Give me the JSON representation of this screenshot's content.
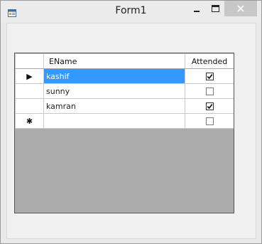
{
  "window": {
    "title": "Form1",
    "minimize_glyph": "—",
    "maximize_glyph": "☐",
    "close_glyph": "✕"
  },
  "grid": {
    "columns": [
      "EName",
      "Attended"
    ],
    "current_row_glyph": "▶",
    "new_row_glyph": "✱",
    "rows": [
      {
        "ename": "kashif",
        "attended": true,
        "selected": true
      },
      {
        "ename": "sunny",
        "attended": false,
        "selected": false
      },
      {
        "ename": "kamran",
        "attended": true,
        "selected": false
      },
      {
        "ename": "",
        "attended": false,
        "selected": false
      }
    ]
  },
  "colors": {
    "selection": "#3399ff",
    "grid_background": "#ababab"
  }
}
